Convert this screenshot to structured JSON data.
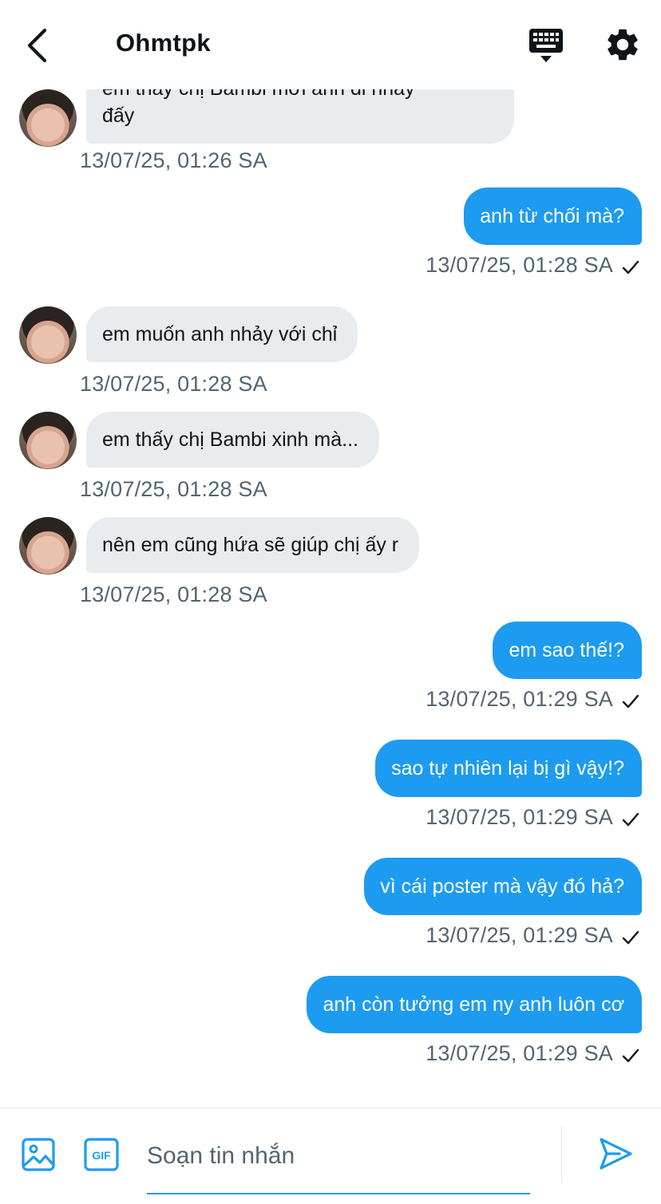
{
  "header": {
    "title": "Ohmtpk",
    "icons": {
      "back": "back-arrow-icon",
      "keyboard": "keyboard-icon",
      "settings": "gear-icon"
    }
  },
  "messages": [
    {
      "dir": "in",
      "text_line1": "em thấy chị Bambi mời anh đi nhảy",
      "text_line2": "đấy",
      "time": "13/07/25, 01:26 SA"
    },
    {
      "dir": "out",
      "text": "anh từ chối mà?",
      "time": "13/07/25, 01:28 SA"
    },
    {
      "dir": "in",
      "text": "em muốn anh nhảy với chỉ",
      "time": "13/07/25, 01:28 SA"
    },
    {
      "dir": "in",
      "text": "em thấy chị Bambi xinh mà...",
      "time": "13/07/25, 01:28 SA"
    },
    {
      "dir": "in",
      "text": "nên em cũng hứa sẽ giúp chị ấy r",
      "time": "13/07/25, 01:28 SA"
    },
    {
      "dir": "out",
      "text": "em sao thế!?",
      "time": "13/07/25, 01:29 SA"
    },
    {
      "dir": "out",
      "text": "sao tự nhiên lại bị gì vậy!?",
      "time": "13/07/25, 01:29 SA"
    },
    {
      "dir": "out",
      "text": "vì cái poster mà vậy đó hả?",
      "time": "13/07/25, 01:29 SA"
    },
    {
      "dir": "out",
      "text": "anh còn tưởng em ny anh luôn cơ",
      "time": "13/07/25, 01:29 SA"
    }
  ],
  "composer": {
    "placeholder": "Soạn tin nhắn",
    "value": "",
    "icons": {
      "image": "image-icon",
      "gif": "gif-icon",
      "send": "send-icon"
    },
    "gif_label": "GIF"
  },
  "colors": {
    "accent": "#1d9bf0",
    "incoming_bubble": "#e8ecef",
    "timestamp": "#536471",
    "text": "#0f1419"
  }
}
